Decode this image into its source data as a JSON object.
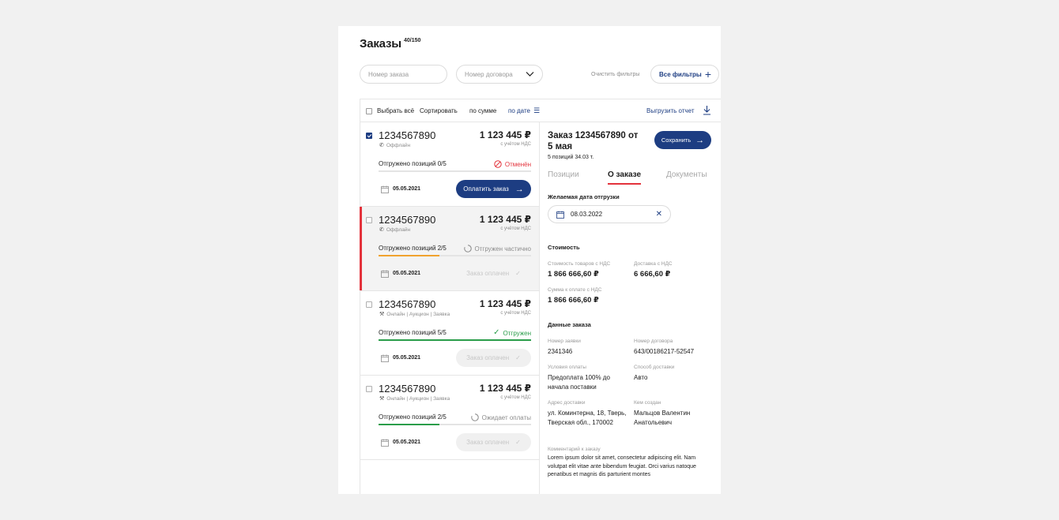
{
  "header": {
    "title": "Заказы",
    "count": "40/150"
  },
  "filters": {
    "order_placeholder": "Номер заказа",
    "contract_placeholder": "Номер договора",
    "clear": "Очистить фильтры",
    "all": "Все фильтры"
  },
  "toolbar": {
    "select_all": "Выбрать всё",
    "sort": "Сортировать",
    "by_sum": "по сумме",
    "by_date": "по дате",
    "export": "Выгрузить отчет"
  },
  "orders": [
    {
      "number": "1234567890",
      "channel": "Оффлайн",
      "amount": "1 123 445 ₽",
      "vat": "с учётом НДС",
      "shipped": "Отгружено позиций 0/5",
      "status": "Отменён",
      "date": "05.05.2021",
      "action": "Оплатить заказ",
      "progress": 0.0,
      "checked": true
    },
    {
      "number": "1234567890",
      "channel": "Оффлайн",
      "amount": "1 123 445 ₽",
      "vat": "с учётом НДС",
      "shipped": "Отгружено позиций 2/5",
      "status": "Отгружен частично",
      "date": "05.05.2021",
      "action": "Заказ оплачен",
      "progress": 0.4,
      "checked": false
    },
    {
      "number": "1234567890",
      "channel": "Онлайн | Аукцион | Заявка",
      "amount": "1 123 445 ₽",
      "vat": "с учётом НДС",
      "shipped": "Отгружено позиций 5/5",
      "status": "Отгружен",
      "date": "05.05.2021",
      "action": "Заказ оплачен",
      "progress": 1.0,
      "checked": false
    },
    {
      "number": "1234567890",
      "channel": "Онлайн | Аукцион | Заявка",
      "amount": "1 123 445 ₽",
      "vat": "с учётом НДС",
      "shipped": "Отгружено позиций 2/5",
      "status": "Ожидает оплаты",
      "date": "05.05.2021",
      "action": "Заказ оплачен",
      "progress": 0.4,
      "checked": false
    }
  ],
  "colors": {
    "accent": "#1d3d82",
    "danger": "#e3323b",
    "success": "#2a9d4a",
    "warning": "#f0a22e"
  },
  "detail": {
    "title": "Заказ 1234567890 от 5 мая",
    "subtitle": "5 позиций 34.03 т.",
    "save": "Сохранить",
    "tabs": [
      "Позиции",
      "О заказе",
      "Документы"
    ],
    "desired_date_label": "Желаемая дата отгрузки",
    "desired_date": "08.03.2022",
    "cost_label": "Стоимость",
    "goods_cost_label": "Стоимость товаров с НДС",
    "goods_cost": "1 866 666,60 ₽",
    "delivery_cost_label": "Доставка с НДС",
    "delivery_cost": "6 666,60 ₽",
    "total_label": "Сумма к оплате с НДС",
    "total": "1 866 666,60 ₽",
    "order_data_label": "Данные заказа",
    "request_no_label": "Номер заявки",
    "request_no": "2341346",
    "contract_no_label": "Номер договора",
    "contract_no": "643/00186217-52547",
    "payment_terms_label": "Условия оплаты",
    "payment_terms": "Предоплата 100% до начала поставки",
    "delivery_method_label": "Способ доставки",
    "delivery_method": "Авто",
    "address_label": "Адрес доставки",
    "address": "ул. Коминтерна, 18, Тверь, Тверская обл., 170002",
    "created_by_label": "Кем создан",
    "created_by": "Мальцов Валентин Анатольевич",
    "comment_label": "Комментарий к заказу",
    "comment": "Lorem ipsum dolor sit amet, consectetur adipiscing elit. Nam volutpat elit vitae ante bibendum feugiat. Orci varius natoque penatibus et magnis dis parturient montes"
  }
}
